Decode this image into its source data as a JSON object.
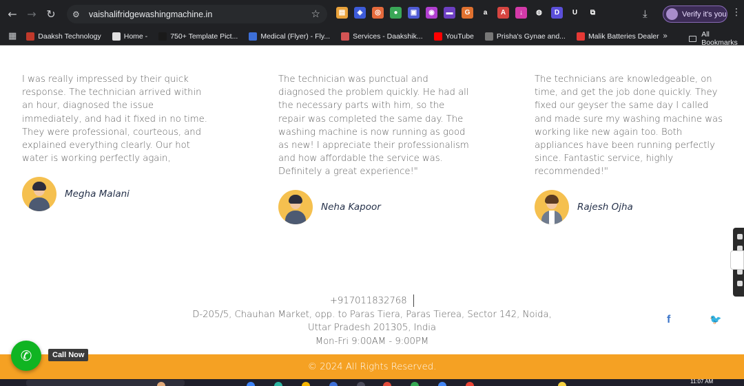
{
  "browser": {
    "url": "vaishalifridgewashingmachine.in",
    "profile_label": "Verify it's you",
    "extensions": [
      {
        "icon": "image-ext-icon",
        "color": "#e9a23b",
        "glyph": "▤"
      },
      {
        "icon": "shield-ext-icon",
        "color": "#3d5bd9",
        "glyph": "◈"
      },
      {
        "icon": "camera-ext-icon",
        "color": "#e56a3c",
        "glyph": "◎"
      },
      {
        "icon": "chrome-ext-icon",
        "color": "#3aa757",
        "glyph": "●"
      },
      {
        "icon": "screen-ext-icon",
        "color": "#4f5bd5",
        "glyph": "▣"
      },
      {
        "icon": "circle-ext-icon",
        "color": "#b13fd0",
        "glyph": "◉"
      },
      {
        "icon": "film-ext-icon",
        "color": "#6d3fc2",
        "glyph": "▬"
      },
      {
        "icon": "grammarly-ext-icon",
        "color": "#e0712f",
        "glyph": "G"
      },
      {
        "icon": "amazon-ext-icon",
        "color": "#202124",
        "glyph": "a"
      },
      {
        "icon": "pdf-ext-icon",
        "color": "#d64541",
        "glyph": "A"
      },
      {
        "icon": "download-ext-icon",
        "color": "#d33aa8",
        "glyph": "↓"
      },
      {
        "icon": "bot-ext-icon",
        "color": "#202124",
        "glyph": "◍"
      },
      {
        "icon": "d-ext-icon",
        "color": "#5b4fd9",
        "glyph": "D"
      },
      {
        "icon": "u-ext-icon",
        "color": "#202124",
        "glyph": "U"
      },
      {
        "icon": "puzzle-ext-icon",
        "color": "#202124",
        "glyph": "⧉"
      }
    ],
    "bookmarks": [
      {
        "label": "Daaksh Technology",
        "color": "#c0392b"
      },
      {
        "label": "Home -",
        "color": "#e0e0e0"
      },
      {
        "label": "750+ Template Pict...",
        "color": "#1a1a1a"
      },
      {
        "label": "Medical (Flyer) - Fly...",
        "color": "#3d6fd8"
      },
      {
        "label": "Services - Daakshik...",
        "color": "#d35454"
      },
      {
        "label": "YouTube",
        "color": "#ff0000"
      },
      {
        "label": "Prisha's Gynae and...",
        "color": "#777777"
      },
      {
        "label": "Malik Batteries Dealer",
        "color": "#e53935"
      }
    ],
    "all_bookmarks_label": "All Bookmarks"
  },
  "testimonials": [
    {
      "text": "I was really impressed by their quick response. The technician arrived within an hour, diagnosed the issue immediately, and had it fixed in no time. They were professional, courteous, and explained everything clearly. Our hot water is working perfectly again,",
      "name": "Megha Malani"
    },
    {
      "text": "The technician was punctual and diagnosed the problem quickly. He had all the necessary parts with him, so the repair was completed the same day. The washing machine is now running as good as new! I appreciate their professionalism and how affordable the service was. Definitely a great experience!\"",
      "name": "Neha Kapoor"
    },
    {
      "text": "The technicians are knowledgeable, on time, and get the job done quickly. They fixed our geyser the same day I called and made sure my washing machine was working like new again too. Both appliances have been running perfectly since. Fantastic service, highly recommended!\"",
      "name": "Rajesh Ojha"
    }
  ],
  "contact": {
    "phone": "+917011832768",
    "address_line1": "D-205/5, Chauhan Market, opp. to Paras Tiera, Paras Tierea, Sector 142, Noida,",
    "address_line2": "Uttar Pradesh 201305, India",
    "hours": "Mon-Fri 9:00AM - 9:00PM"
  },
  "social": {
    "facebook": "f",
    "twitter": "🐦"
  },
  "footer": {
    "copyright": "© 2024 All Rights Reserved."
  },
  "call_now": {
    "label": "Call Now"
  },
  "taskbar": {
    "time": "11:07 AM"
  }
}
